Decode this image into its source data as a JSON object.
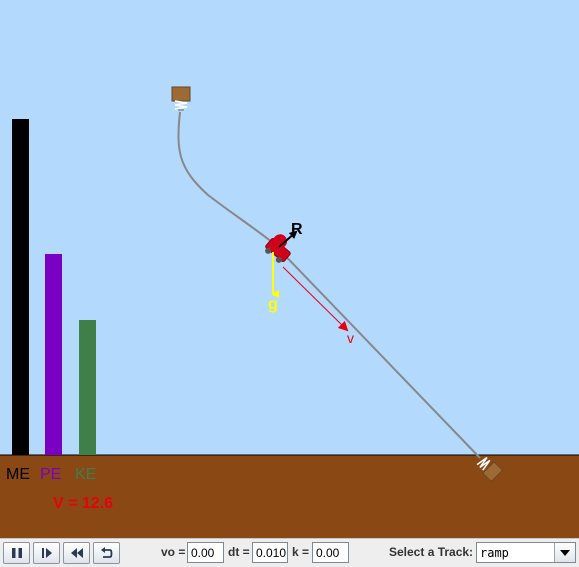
{
  "energy": {
    "labels": {
      "me": "ME",
      "pe": "PE",
      "ke": "KE"
    },
    "values": {
      "me": 1.0,
      "pe": 0.598,
      "ke": 0.402
    },
    "colors": {
      "me": "#000000",
      "pe": "#7a00c4",
      "ke": "#3e7f4a"
    }
  },
  "speed_text": "V = 12.6",
  "vectors": {
    "reaction": "R",
    "gravity": "g",
    "velocity": "v"
  },
  "colors": {
    "sky": "#b3d9fd",
    "ground": "#8a4814",
    "track": "#808080",
    "cart": "#d0021b",
    "speed": "#e8000e",
    "gravity": "#ffff00"
  },
  "controls": {
    "buttons": [
      "pause-icon",
      "step-icon",
      "rewind-icon",
      "reset-icon"
    ],
    "vo": {
      "label": "vo =",
      "value": "0.00"
    },
    "dt": {
      "label": "dt =",
      "value": "0.010"
    },
    "k": {
      "label": "k =",
      "value": "0.00"
    },
    "track": {
      "label": "Select a Track:",
      "value": "ramp"
    }
  }
}
